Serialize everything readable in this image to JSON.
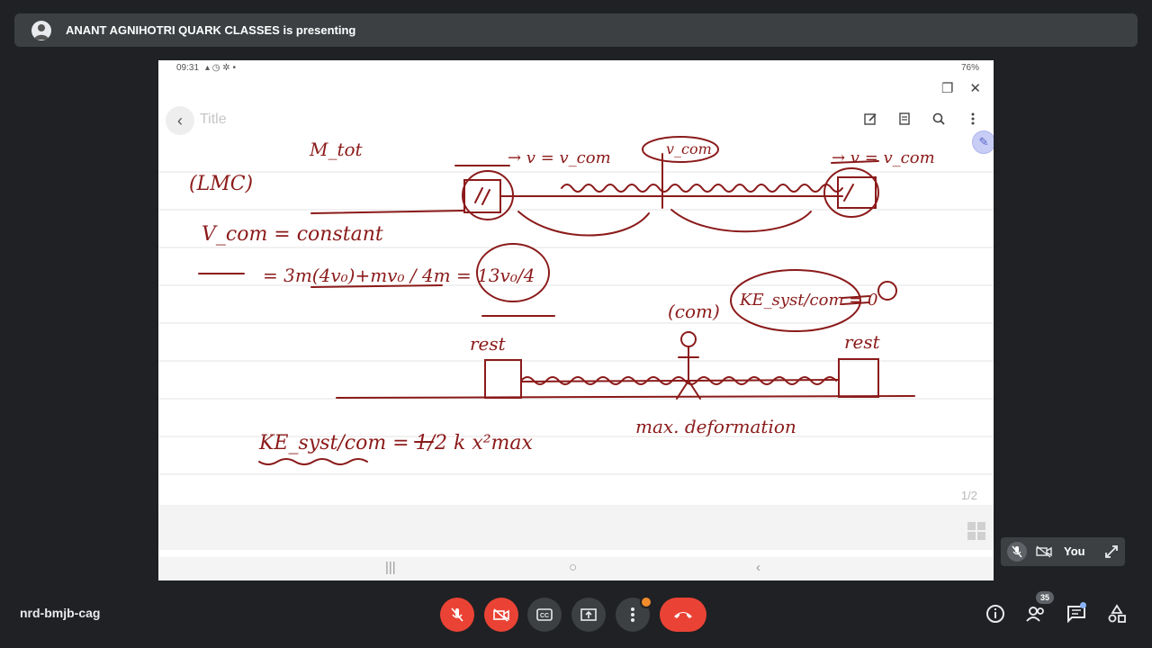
{
  "presenter": {
    "banner": "ANANT AGNIHOTRI QUARK CLASSES is presenting",
    "avatar_icon": "presenter-avatar"
  },
  "shared_screen": {
    "status_time": "09:31",
    "status_icons_left": "▴ ◷ ✲ •",
    "status_battery": "76%",
    "app_title_placeholder": "Title",
    "page_counter": "1/2",
    "toolbar_icons": [
      "edit-icon",
      "reader-icon",
      "search-icon",
      "more-icon"
    ],
    "nav_buttons": [
      "recents",
      "home",
      "back"
    ],
    "notes": {
      "m_tot": "M_tot",
      "lmc": "(LMC)",
      "vcom_const": "V_com = constant",
      "equation": "= 3m(4v₀)+mv₀ / 4m = 13v₀/4",
      "v_eq_vcom_left": "→ v = v_com",
      "v_eq_vcom_right": "→ v = v_com",
      "vcom_top": "v_com",
      "com_label": "(com)",
      "ke_zero": "KE_syst/com = 0",
      "rest_left": "rest",
      "rest_right": "rest",
      "max_def": "max. deformation",
      "ke_formula": "KE_syst/com = 1/2 k x²max"
    }
  },
  "call": {
    "meeting_code": "nrd-bmjb-cag",
    "participants_count": "35",
    "self_name": "You",
    "controls": [
      "mic-off",
      "camera-off",
      "captions",
      "present",
      "more",
      "end-call"
    ],
    "colors": {
      "red": "#ea4335",
      "bar": "#202124",
      "tile": "#3c4043",
      "ink": "#8b1a1a"
    }
  }
}
